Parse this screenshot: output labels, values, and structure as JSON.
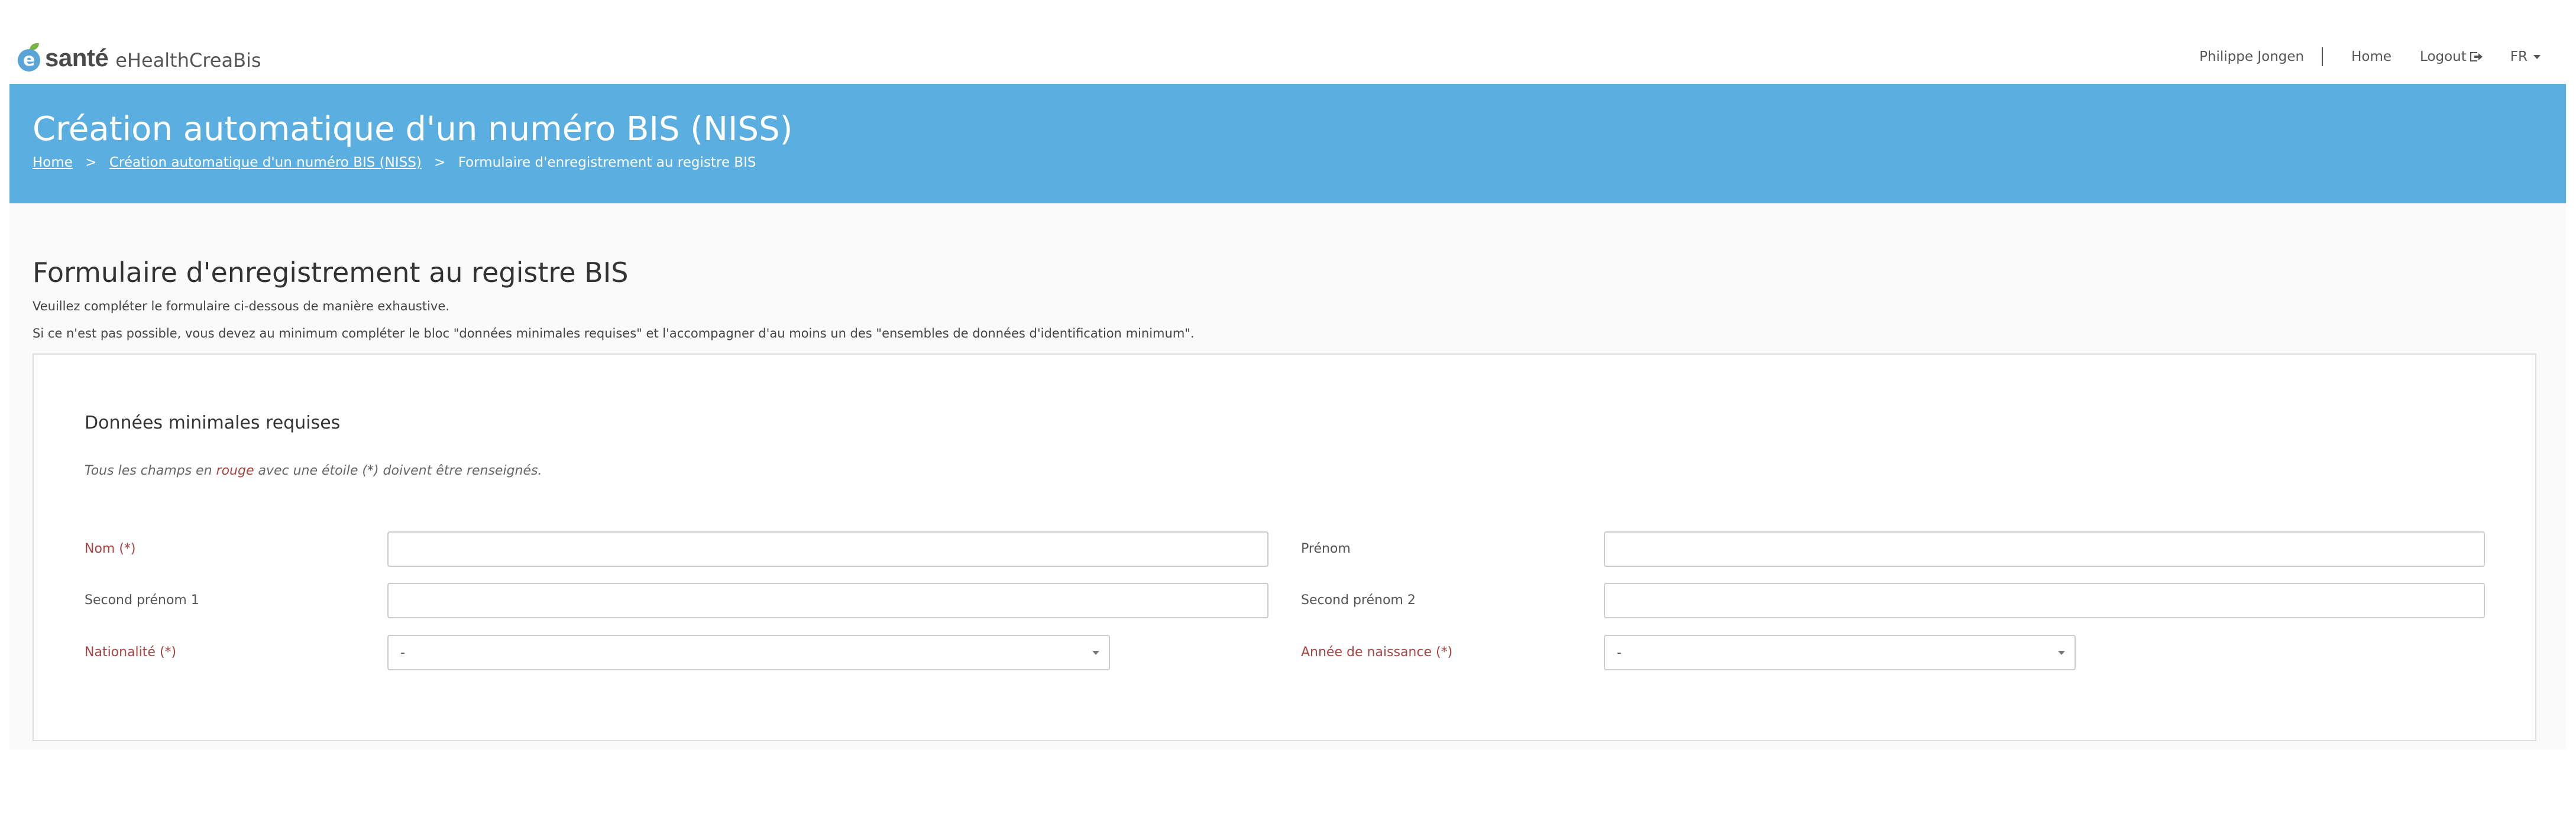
{
  "header": {
    "brand": "santé",
    "logo_letter": "e",
    "app_name": "eHealthCreaBis",
    "user_name": "Philippe Jongen",
    "nav_home": "Home",
    "nav_logout": "Logout",
    "language": "FR"
  },
  "banner": {
    "title": "Création automatique d'un numéro BIS (NISS)",
    "breadcrumb": [
      "Home",
      "Création automatique d'un numéro BIS (NISS)",
      "Formulaire d'enregistrement au registre BIS"
    ],
    "separator": ">"
  },
  "form": {
    "title": "Formulaire d'enregistrement au registre BIS",
    "intro_1": "Veuillez compléter le formulaire ci-dessous de manière exhaustive.",
    "intro_2": "Si ce n'est pas possible, vous devez au minimum compléter le bloc \"données minimales requises\" et l'accompagner d'au moins un des \"ensembles de données d'identification minimum\"."
  },
  "panel": {
    "title": "Données minimales requises",
    "note_before": "Tous les champs en ",
    "note_red": "rouge",
    "note_after": " avec une étoile (*) doivent être renseignés.",
    "fields": {
      "nom": {
        "label": "Nom (*)",
        "value": ""
      },
      "prenom": {
        "label": "Prénom",
        "value": ""
      },
      "second_prenom_1": {
        "label": "Second prénom 1",
        "value": ""
      },
      "second_prenom_2": {
        "label": "Second prénom 2",
        "value": ""
      },
      "nationalite": {
        "label": "Nationalité (*)",
        "selected": "-"
      },
      "annee_naissance": {
        "label": "Année de naissance (*)",
        "selected": "-"
      }
    }
  },
  "colors": {
    "banner": "#5aaee0",
    "required": "#a94442",
    "logo_blue": "#5aa5d8",
    "logo_green": "#7ab342"
  }
}
